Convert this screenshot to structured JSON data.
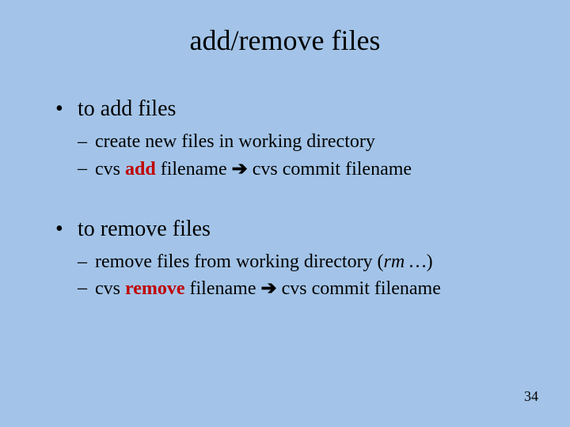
{
  "title": "add/remove files",
  "bullet1": "to add files",
  "sub1a": "create new files in working directory",
  "sub1b_pre": "cvs ",
  "sub1b_cmd": "add",
  "sub1b_mid": " filename ",
  "arrow": "➔",
  "sub1b_post": "  cvs commit  filename",
  "bullet2": "to remove files",
  "sub2a_pre": "remove files from working directory (",
  "sub2a_rm": "rm …",
  "sub2a_post": ")",
  "sub2b_pre": "cvs ",
  "sub2b_cmd": "remove",
  "sub2b_mid": " filename ",
  "sub2b_post": "  cvs commit  filename",
  "pagenum": "34"
}
